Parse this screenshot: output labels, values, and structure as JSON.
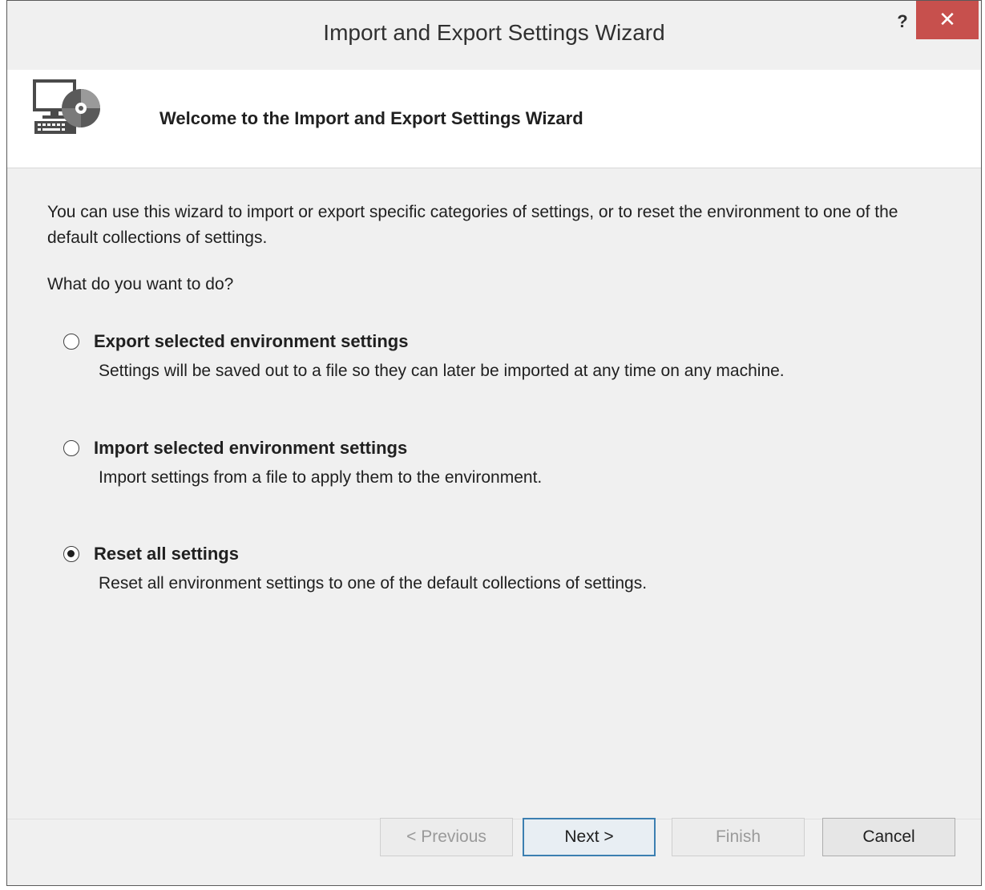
{
  "window": {
    "title": "Import and Export Settings Wizard",
    "help_label": "?",
    "close_label": "✕"
  },
  "header": {
    "title": "Welcome to the Import and Export Settings Wizard",
    "icon": "settings-wizard-icon"
  },
  "content": {
    "intro": "You can use this wizard to import or export specific categories of settings, or to reset the environment to one of the default collections of settings.",
    "question": "What do you want to do?",
    "options": [
      {
        "label": "Export selected environment settings",
        "description": "Settings will be saved out to a file so they can later be imported at any time on any machine.",
        "selected": false
      },
      {
        "label": "Import selected environment settings",
        "description": "Import settings from a file to apply them to the environment.",
        "selected": false
      },
      {
        "label": "Reset all settings",
        "description": "Reset all environment settings to one of the default collections of settings.",
        "selected": true
      }
    ]
  },
  "buttons": {
    "previous": "< Previous",
    "next": "Next >",
    "finish": "Finish",
    "cancel": "Cancel"
  },
  "colors": {
    "close_button": "#c7504d",
    "default_button_border": "#3c7fb1",
    "window_background": "#f0f0f0",
    "header_background": "#ffffff"
  }
}
